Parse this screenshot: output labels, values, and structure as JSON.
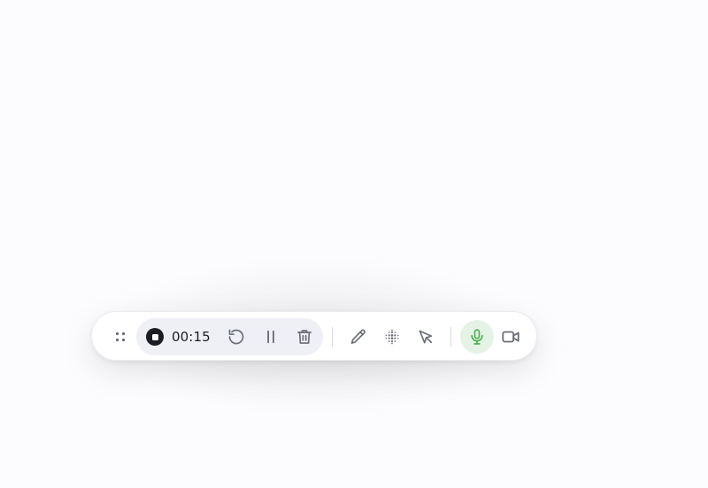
{
  "recorder": {
    "timer": "00:15",
    "state": "recording",
    "mic_enabled": true,
    "colors": {
      "toolbar_bg": "#ffffff",
      "record_group_bg": "#eef0f6",
      "stop_button": "#1c1d22",
      "icon_gray": "#6b6e76",
      "mic_active_bg": "#e4f3e6",
      "mic_active_icon": "#4caf50"
    },
    "icons": {
      "drag": "drag-handle-icon",
      "stop": "stop-icon",
      "restart": "restart-icon",
      "pause": "pause-icon",
      "delete": "trash-icon",
      "draw": "pencil-icon",
      "blur": "blur-icon",
      "pointer": "cursor-icon",
      "microphone": "microphone-icon",
      "camera": "video-camera-icon"
    }
  }
}
